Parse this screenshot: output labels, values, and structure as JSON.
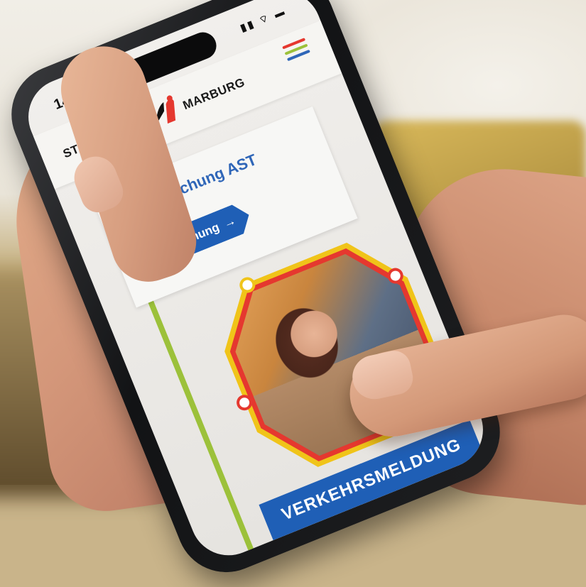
{
  "phone": {
    "status_time": "14:47",
    "status_icons": "▮▮ ⌔ ▬"
  },
  "header": {
    "logo_left": "STADTWERKE",
    "logo_right": "MARBURG",
    "menu_colors": [
      "#e5382f",
      "#9cc13a",
      "#2f66b8"
    ]
  },
  "card": {
    "title": "Onlinebuchung AST",
    "button_label": "zur Buchung",
    "button_arrow": "→"
  },
  "banner": {
    "label": "VERKEHRSMELDUNG"
  },
  "colors": {
    "brand_blue": "#1f5fb6",
    "line_green": "#9cc13a",
    "line_yellow": "#f0c419",
    "line_red": "#e5382f"
  }
}
